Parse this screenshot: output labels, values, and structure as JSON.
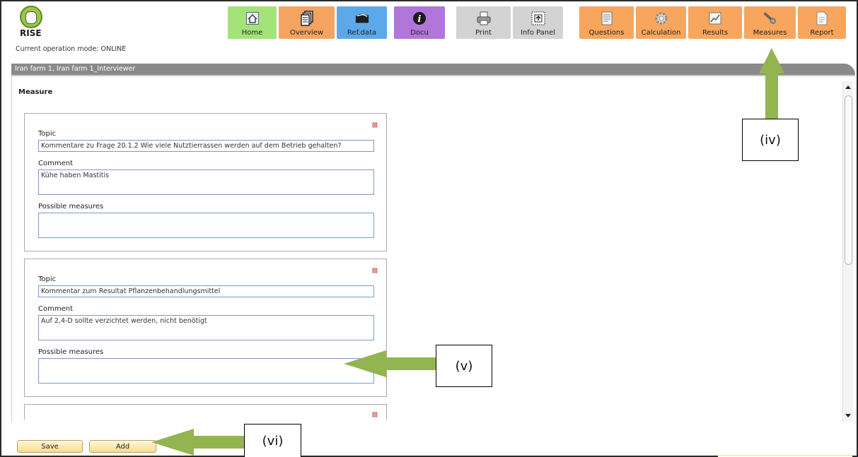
{
  "app": {
    "logo_text": "RISE",
    "operation_mode": "Current operation mode: ONLINE"
  },
  "nav": {
    "home": {
      "label": "Home",
      "icon": "home-icon"
    },
    "overview": {
      "label": "Overview",
      "icon": "documents-icon"
    },
    "refdata": {
      "label": "Ref.data",
      "icon": "folder-icon"
    },
    "docu": {
      "label": "Docu",
      "icon": "info-icon"
    },
    "print": {
      "label": "Print",
      "icon": "printer-icon"
    },
    "infopanel": {
      "label": "Info Panel",
      "icon": "info-panel-icon"
    },
    "questions": {
      "label": "Questions",
      "icon": "questions-icon"
    },
    "calculation": {
      "label": "Calculation",
      "icon": "gear-icon"
    },
    "results": {
      "label": "Results",
      "icon": "chart-icon"
    },
    "measures": {
      "label": "Measures",
      "icon": "wrench-icon"
    },
    "report": {
      "label": "Report",
      "icon": "report-icon"
    }
  },
  "title_bar": "Iran farm 1, Iran farm 1_Interviewer",
  "section_title": "Measure",
  "labels": {
    "topic": "Topic",
    "comment": "Comment",
    "possible_measures": "Possible measures"
  },
  "cards": [
    {
      "topic": "Kommentare zu Frage 20.1.2 Wie viele Nutztierrassen werden auf dem Betrieb gehalten?",
      "comment": "Kühe haben Mastitis",
      "possible_measures": ""
    },
    {
      "topic": "Kommentar zum Resultat Pflanzenbehandlungsmittel",
      "comment": "Auf 2,4-D sollte verzichtet werden, nicht benötigt",
      "possible_measures": ""
    }
  ],
  "close_glyph": "⊠",
  "buttons": {
    "save": "Save",
    "add": "Add"
  },
  "annotations": {
    "iv": "(iv)",
    "v": "(v)",
    "vi": "(vi)"
  },
  "colors": {
    "home": "#a4e27a",
    "overview": "#f4a460",
    "refdata": "#5ca8e8",
    "docu": "#b176d9",
    "utility": "#d3d3d3",
    "workflow": "#f8a65d",
    "arrow": "#92b552"
  }
}
